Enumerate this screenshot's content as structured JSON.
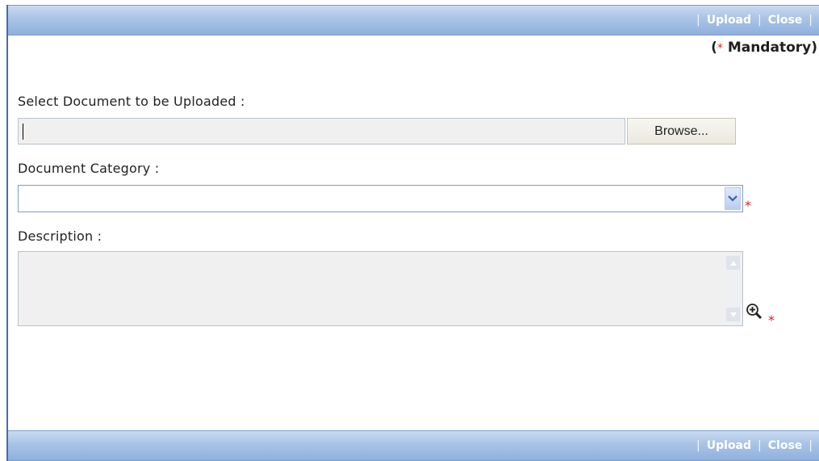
{
  "toolbar": {
    "upload_label": "Upload",
    "close_label": "Close",
    "separator": "|"
  },
  "mandatory": {
    "open": "(",
    "star": "*",
    "text": "Mandatory)"
  },
  "form": {
    "document_label": "Select Document to be Uploaded :",
    "browse_label": "Browse...",
    "category_label": "Document Category :",
    "category_value": "",
    "description_label": "Description :",
    "description_value": "",
    "required_marker": "*"
  },
  "icons": {
    "dropdown": "chevron-down-icon",
    "zoom": "zoom-in-icon",
    "scroll_up": "triangle-up-icon",
    "scroll_down": "triangle-down-icon"
  },
  "colors": {
    "bar": "#a9c3e6",
    "required": "#dd2222",
    "frame_border": "#3f6fb0"
  }
}
